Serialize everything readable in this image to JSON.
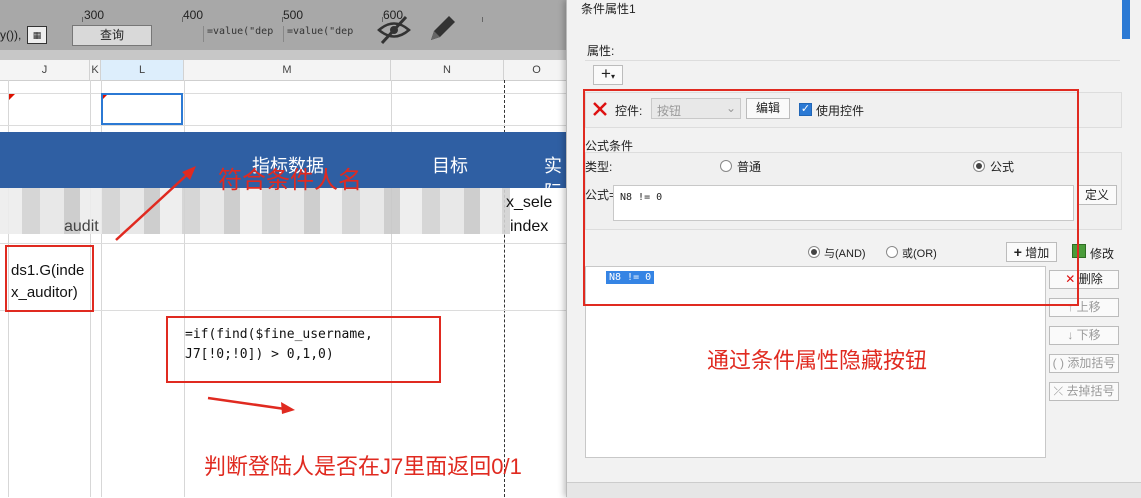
{
  "spreadsheet": {
    "ruler_numbers": [
      "300",
      "400",
      "500",
      "600"
    ],
    "toolbar": {
      "left_snippet": "y()),",
      "calc_button": "查询",
      "formula_snippets": [
        "=value(\"dep",
        "=value(\"dep"
      ]
    },
    "columns": [
      "J",
      "K",
      "L",
      "M",
      "N",
      "O"
    ],
    "header_row": {
      "texts": [
        "指标数据",
        "目标",
        "实际"
      ]
    },
    "blurred_row_texts": [
      "x_sele",
      "index",
      "audit"
    ],
    "cell_auditor": "ds1.G(index_auditor)",
    "formula_cell": "=if(find($fine_username,\nJ7[!0;!0]) > 0,1,0)"
  },
  "annotations": {
    "name_label": "符合条件人名",
    "judge_label": "判断登陆人是否在J7里面返回0/1",
    "hide_label": "通过条件属性隐藏按钮"
  },
  "dialog": {
    "title": "条件属性1",
    "property_label": "属性:",
    "add_symbol": "+",
    "control_label": "控件:",
    "control_select": "按钮",
    "edit_button": "编辑",
    "use_control_label": "使用控件",
    "use_control_checked": true,
    "formula_section": "公式条件",
    "type_label": "类型:",
    "type_normal": "普通",
    "type_formula": "公式",
    "type_selected": "公式",
    "formula_label": "公式=",
    "formula_value": "N8 != 0",
    "define_button": "定义",
    "and_label": "与(AND)",
    "or_label": "或(OR)",
    "logic_selected": "与(AND)",
    "add_button": "增加",
    "modify_button": "修改",
    "condition_list": [
      "N8 != 0"
    ],
    "delete_button": "删除",
    "move_up_button": "上移",
    "move_down_button": "下移",
    "add_paren_button": "添加括号",
    "remove_paren_button": "去掉括号"
  }
}
